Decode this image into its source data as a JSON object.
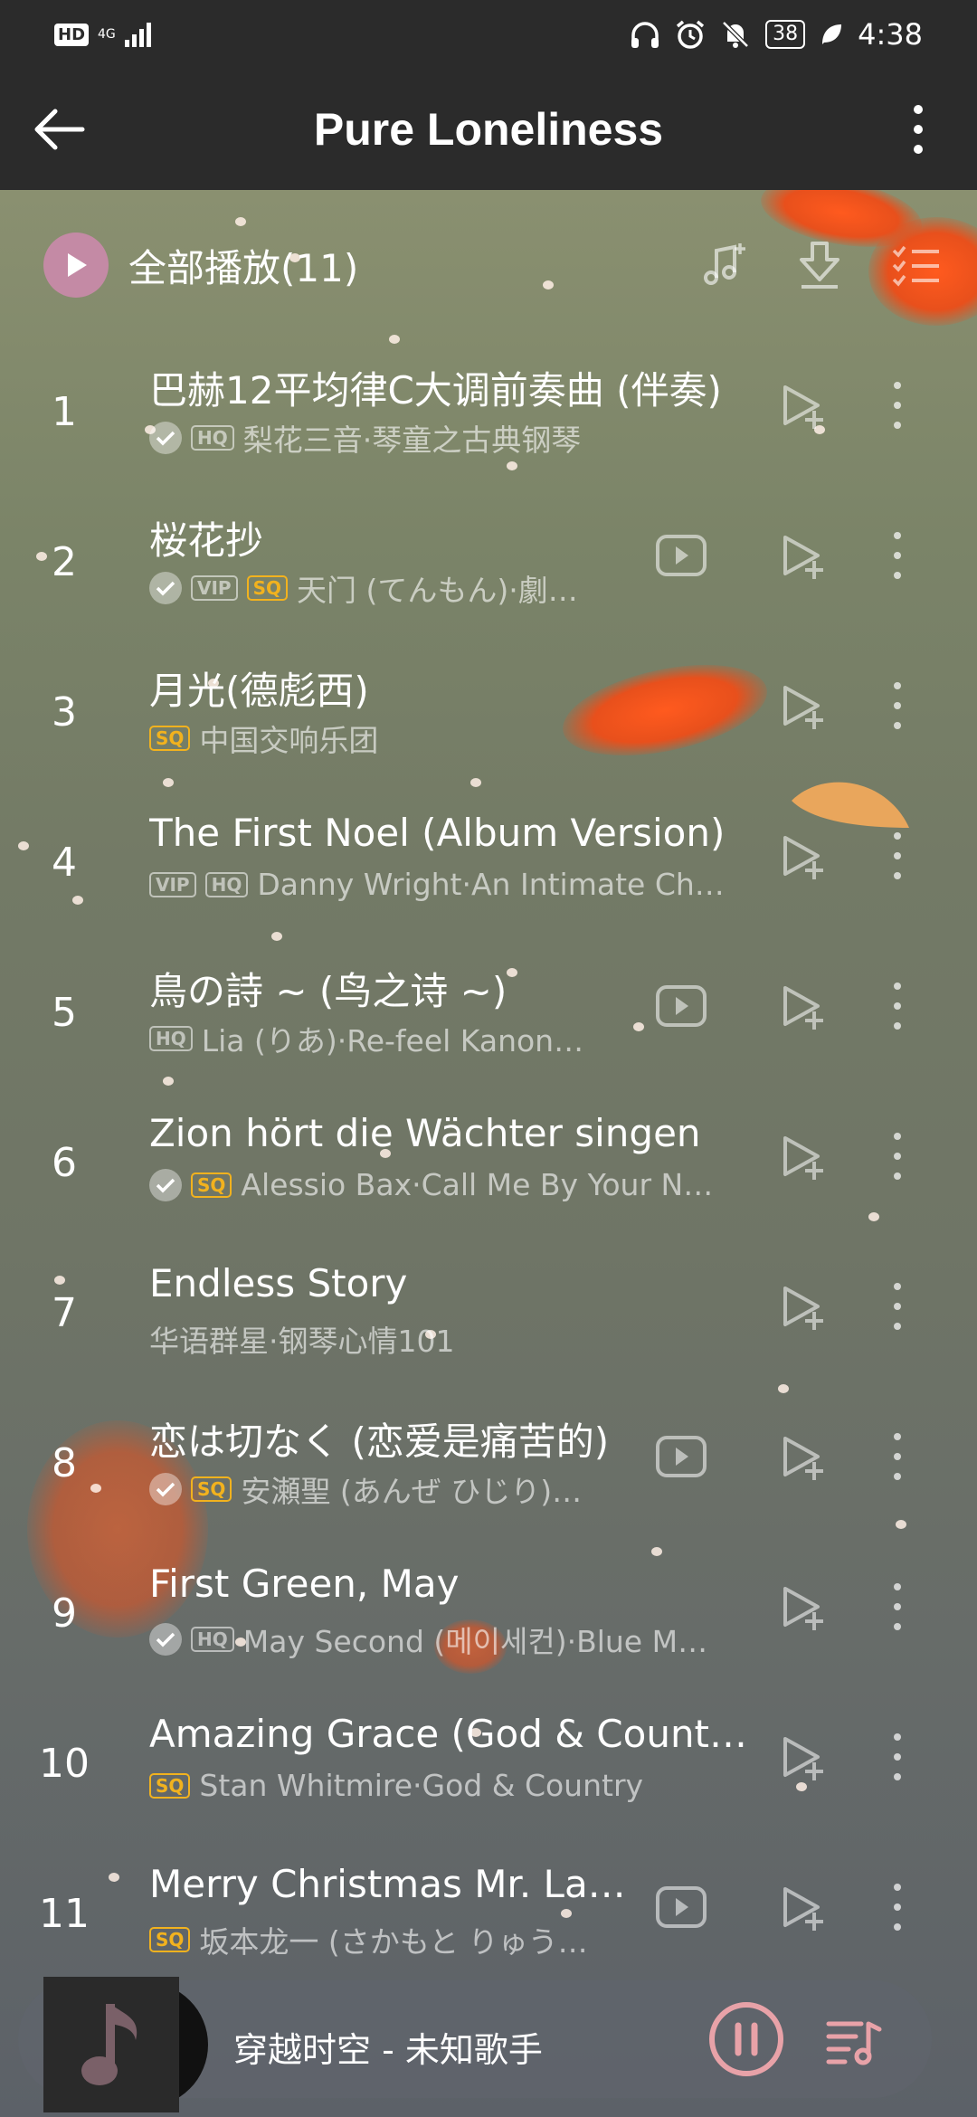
{
  "status": {
    "hd": "HD",
    "network": "4G",
    "battery": "38",
    "time": "4:38"
  },
  "header": {
    "title": "Pure Loneliness"
  },
  "play_all": {
    "label": "全部播放(11)"
  },
  "songs": [
    {
      "num": "1",
      "title": "巴赫12平均律C大调前奏曲 (伴奏)",
      "liked": true,
      "badges": [
        "HQ"
      ],
      "subtitle": "梨花三音·琴童之古典钢琴",
      "mv": false
    },
    {
      "num": "2",
      "title": "桜花抄",
      "liked": true,
      "badges": [
        "VIP",
        "SQ"
      ],
      "subtitle": "天门 (てんもん)·劇…",
      "mv": true
    },
    {
      "num": "3",
      "title": "月光(德彪西)",
      "liked": false,
      "badges": [
        "SQ"
      ],
      "subtitle": "中国交响乐团",
      "mv": false
    },
    {
      "num": "4",
      "title": "The First Noel (Album Version)",
      "liked": false,
      "badges": [
        "VIP",
        "HQ"
      ],
      "subtitle": "Danny Wright·An Intimate Ch…",
      "mv": false
    },
    {
      "num": "5",
      "title": "鳥の詩 ~ (鸟之诗 ~)",
      "liked": false,
      "badges": [
        "HQ"
      ],
      "subtitle": "Lia (りあ)·Re-feel Kanon…",
      "mv": true
    },
    {
      "num": "6",
      "title": "Zion hört die Wächter singen",
      "liked": true,
      "badges": [
        "SQ"
      ],
      "subtitle": "Alessio Bax·Call Me By Your N…",
      "mv": false
    },
    {
      "num": "7",
      "title": "Endless Story",
      "liked": false,
      "badges": [],
      "subtitle": "华语群星·钢琴心情101",
      "mv": false
    },
    {
      "num": "8",
      "title": "恋は切なく (恋爱是痛苦的)",
      "liked": true,
      "badges": [
        "SQ"
      ],
      "subtitle": "安瀬聖 (あんぜ ひじり)…",
      "mv": true
    },
    {
      "num": "9",
      "title": "First Green, May",
      "liked": true,
      "badges": [
        "HQ"
      ],
      "subtitle": "May Second (메이세컨)·Blue M…",
      "mv": false
    },
    {
      "num": "10",
      "title": "Amazing Grace (God & Count…",
      "liked": false,
      "badges": [
        "SQ"
      ],
      "subtitle": "Stan Whitmire·God & Country",
      "mv": false
    },
    {
      "num": "11",
      "title": "Merry Christmas Mr. La…",
      "liked": false,
      "badges": [
        "SQ"
      ],
      "subtitle": "坂本龙一 (さかもと りゅう…",
      "mv": true
    }
  ],
  "player": {
    "now_playing": "穿越时空 - 未知歌手"
  },
  "colors": {
    "accent": "#c48aa5",
    "sq": "#f2b21e",
    "bar": "#2b2b2b"
  }
}
